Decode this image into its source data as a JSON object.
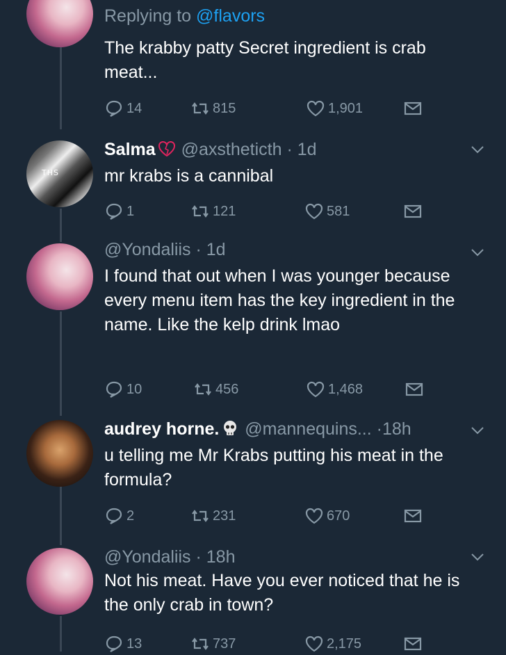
{
  "tweets": [
    {
      "reply_prefix": "Replying to ",
      "reply_handle": "@flavors",
      "text": "The krabby patty Secret ingredient is crab meat...",
      "replies": "14",
      "retweets": "815",
      "likes": "1,901"
    },
    {
      "name": "Salma",
      "handle": "@axstheticth",
      "time": "· 1d",
      "text": "mr krabs is a cannibal",
      "avatar_text": "THS",
      "replies": "1",
      "retweets": "121",
      "likes": "581"
    },
    {
      "handle": "@Yondaliis",
      "time": "· 1d",
      "text": "I found that out when I was younger because every menu item has the key ingredient in the name. Like the kelp drink lmao",
      "replies": "10",
      "retweets": "456",
      "likes": "1,468"
    },
    {
      "name": "audrey horne.",
      "handle": "@mannequins...",
      "time": "·18h",
      "text": "u telling me Mr Krabs putting his meat in the formula?",
      "replies": "2",
      "retweets": "231",
      "likes": "670"
    },
    {
      "handle": "@Yondaliis",
      "time": "· 18h",
      "text": "Not his meat. Have you ever noticed that he is the only crab in town?",
      "replies": "13",
      "retweets": "737",
      "likes": "2,175"
    }
  ],
  "icons": {
    "reply": "reply-icon",
    "retweet": "retweet-icon",
    "like": "heart-icon",
    "dm": "envelope-icon",
    "more": "chevron-down-icon",
    "heart_outline": "broken-heart-emoji",
    "skull": "skull-emoji"
  },
  "colors": {
    "background": "#1b2836",
    "secondary_text": "#8899a6",
    "link": "#1da1f2"
  }
}
